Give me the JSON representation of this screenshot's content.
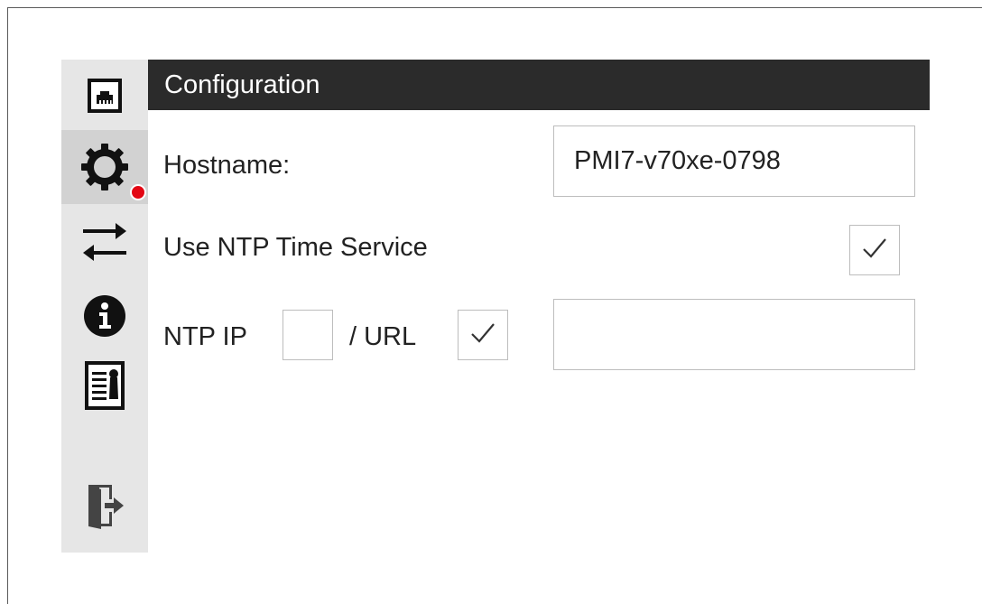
{
  "header": {
    "title": "Configuration"
  },
  "sidebar": {
    "items": [
      {
        "icon": "network-port-icon",
        "active": false
      },
      {
        "icon": "gear-icon",
        "active": true,
        "badge_color": "#e30613"
      },
      {
        "icon": "transfer-arrows-icon",
        "active": false
      },
      {
        "icon": "info-icon",
        "active": false
      },
      {
        "icon": "certificate-document-icon",
        "active": false
      },
      {
        "icon": "logout-door-icon",
        "active": false
      }
    ]
  },
  "form": {
    "hostname_label": "Hostname:",
    "hostname_value": "PMI7-v70xe-0798",
    "ntp_service_label": "Use NTP Time Service",
    "ntp_service_checked": true,
    "ntp_ip_label": "NTP IP",
    "ntp_ip_checked": false,
    "ntp_url_label": "/ URL",
    "ntp_url_checked": true,
    "ntp_address_value": ""
  },
  "colors": {
    "header_bg": "#2b2b2b",
    "sidebar_bg": "#e6e6e6",
    "sidebar_active_bg": "#d2d2d2",
    "badge": "#e30613"
  }
}
